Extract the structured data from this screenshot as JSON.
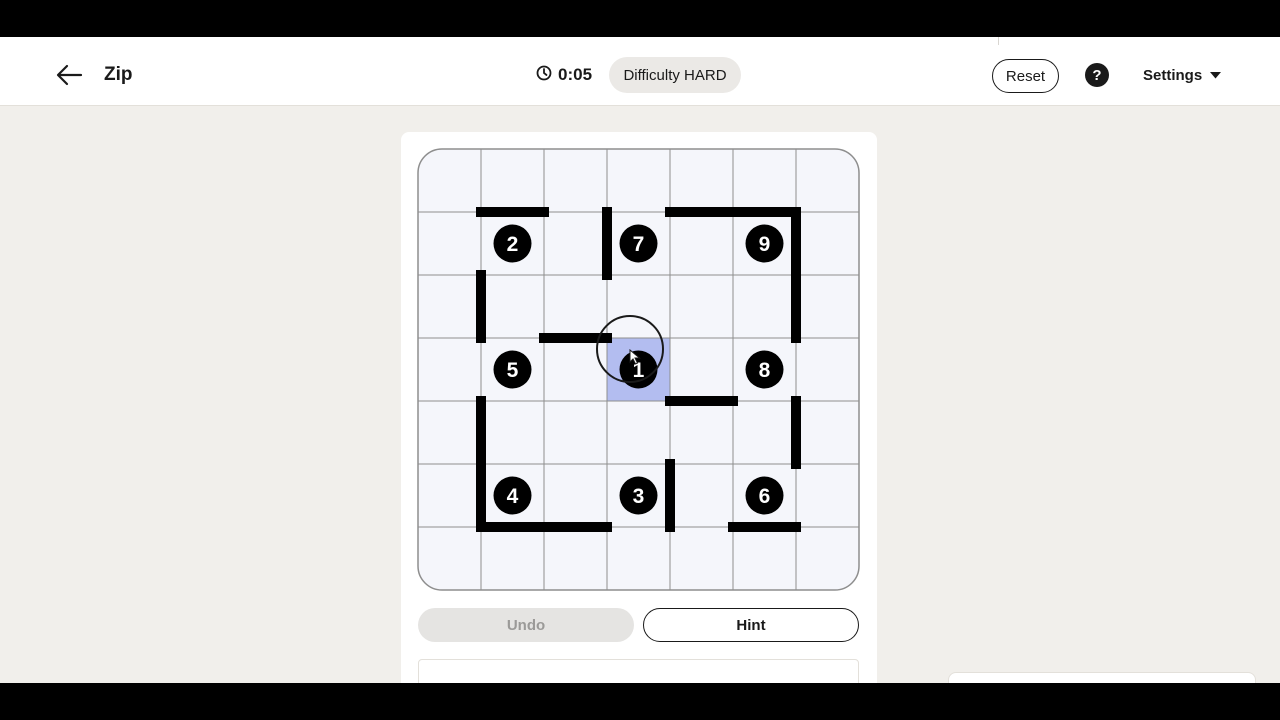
{
  "header": {
    "title": "Zip",
    "timer": "0:05",
    "difficulty": "Difficulty HARD",
    "reset_label": "Reset",
    "help_label": "?",
    "settings_label": "Settings"
  },
  "puzzle": {
    "grid_size": 7,
    "numbers": [
      {
        "value": "2",
        "row": 1,
        "col": 1
      },
      {
        "value": "7",
        "row": 1,
        "col": 3
      },
      {
        "value": "9",
        "row": 1,
        "col": 5
      },
      {
        "value": "5",
        "row": 3,
        "col": 1
      },
      {
        "value": "1",
        "row": 3,
        "col": 3
      },
      {
        "value": "8",
        "row": 3,
        "col": 5
      },
      {
        "value": "4",
        "row": 5,
        "col": 1
      },
      {
        "value": "3",
        "row": 5,
        "col": 3
      },
      {
        "value": "6",
        "row": 5,
        "col": 5
      }
    ],
    "highlighted_cell": {
      "row": 3,
      "col": 3
    },
    "walls": [
      {
        "type": "h",
        "line": 1,
        "from": 1,
        "to": 2
      },
      {
        "type": "h",
        "line": 1,
        "from": 4,
        "to": 6
      },
      {
        "type": "v",
        "line": 3,
        "from": 1,
        "to": 2
      },
      {
        "type": "v",
        "line": 6,
        "from": 1,
        "to": 3
      },
      {
        "type": "v",
        "line": 1,
        "from": 2,
        "to": 3
      },
      {
        "type": "h",
        "line": 3,
        "from": 2,
        "to": 3
      },
      {
        "type": "h",
        "line": 4,
        "from": 4,
        "to": 5
      },
      {
        "type": "v",
        "line": 1,
        "from": 4,
        "to": 6
      },
      {
        "type": "v",
        "line": 6,
        "from": 4,
        "to": 5
      },
      {
        "type": "v",
        "line": 4,
        "from": 5,
        "to": 6
      },
      {
        "type": "h",
        "line": 6,
        "from": 1,
        "to": 3
      },
      {
        "type": "h",
        "line": 6,
        "from": 5,
        "to": 6
      }
    ],
    "colors": {
      "cell_bg": "#f5f6fb",
      "grid_line": "#8e8e8e",
      "wall": "#000000",
      "number_disc": "#000000",
      "highlight": "#b3bdf0"
    }
  },
  "controls": {
    "undo_label": "Undo",
    "hint_label": "Hint"
  }
}
